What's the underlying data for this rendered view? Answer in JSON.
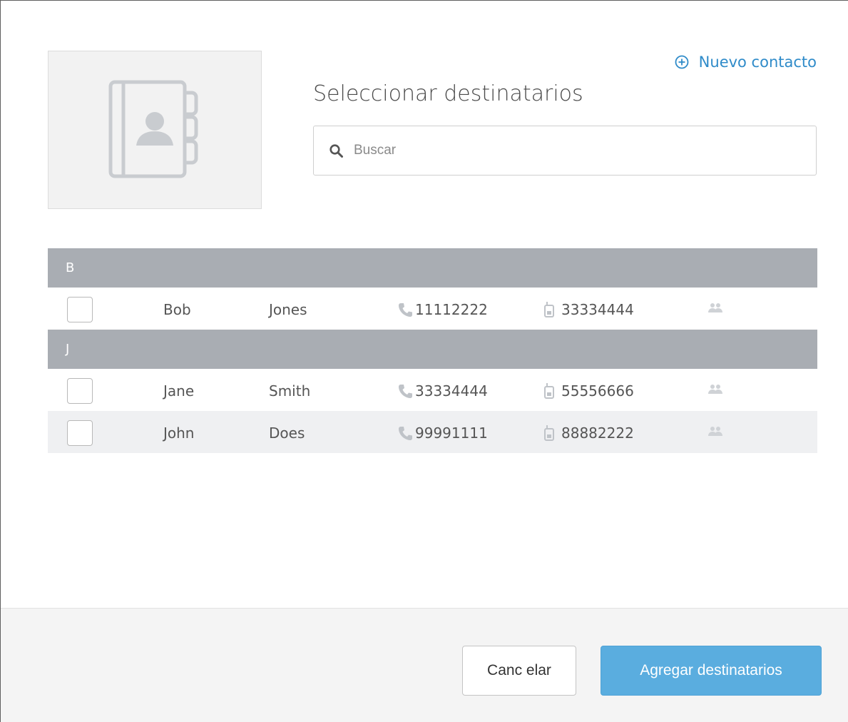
{
  "dialog": {
    "title": "Seleccionar destinatarios",
    "new_contact_label": "Nuevo contacto",
    "avatar_icon": "address-book-icon"
  },
  "search": {
    "placeholder": "Buscar",
    "value": ""
  },
  "groups": [
    {
      "letter": "B",
      "contacts": [
        {
          "first": "Bob",
          "last": "Jones",
          "phone": "11112222",
          "mobile": "33334444",
          "selected": false
        }
      ]
    },
    {
      "letter": "J",
      "contacts": [
        {
          "first": "Jane",
          "last": "Smith",
          "phone": "33334444",
          "mobile": "55556666",
          "selected": false
        },
        {
          "first": "John",
          "last": "Does",
          "phone": "99991111",
          "mobile": "88882222",
          "selected": false
        }
      ]
    }
  ],
  "footer": {
    "cancel_label": "Canc elar",
    "add_label": "Agregar destinatarios"
  },
  "colors": {
    "accent": "#2f8bc9",
    "primary_button": "#5aaddf",
    "group_header": "#a9adb3",
    "row_alt": "#eff0f2",
    "icon_gray": "#c9ccd0"
  }
}
